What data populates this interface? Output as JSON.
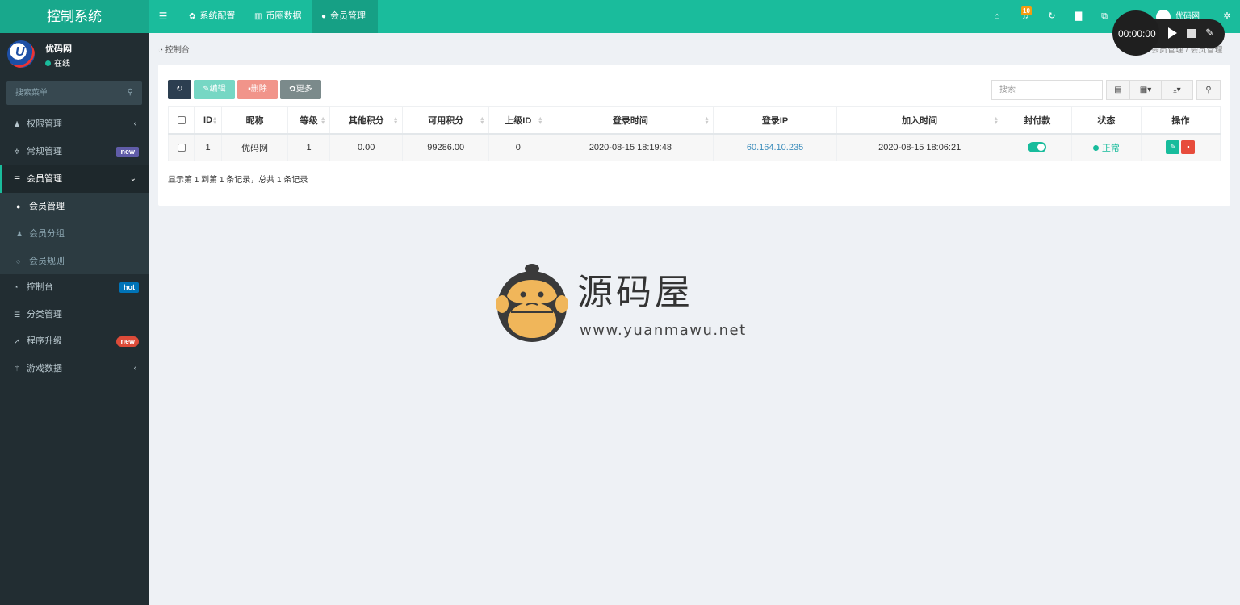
{
  "header": {
    "app_title": "控制系统",
    "tabs": [
      {
        "label": "系统配置",
        "icon": "gear-icon"
      },
      {
        "label": "币圈数据",
        "icon": "bar-chart-icon"
      },
      {
        "label": "会员管理",
        "icon": "user-icon"
      }
    ],
    "notification_count": "10",
    "user_name": "优码网"
  },
  "recorder": {
    "time": "00:00:00"
  },
  "sidebar": {
    "user_name": "优码网",
    "status": "在线",
    "search_placeholder": "搜索菜单",
    "items": [
      {
        "label": "权限管理",
        "icon": "users-icon"
      },
      {
        "label": "常规管理",
        "icon": "cogs-icon",
        "badge": "new"
      },
      {
        "label": "会员管理",
        "icon": "list-icon"
      },
      {
        "label": "控制台",
        "icon": "dashboard-icon",
        "badge": "hot"
      },
      {
        "label": "分类管理",
        "icon": "list-icon"
      },
      {
        "label": "程序升级",
        "icon": "rocket-icon",
        "badge": "new"
      },
      {
        "label": "游戏数据",
        "icon": "magic-icon"
      }
    ],
    "submenu": [
      {
        "label": "会员管理",
        "icon": "user-icon"
      },
      {
        "label": "会员分组",
        "icon": "users-icon"
      },
      {
        "label": "会员规则",
        "icon": "circle-icon"
      }
    ]
  },
  "breadcrumb": {
    "left": "控制台",
    "right_1": "会员管理",
    "right_2": "会员管理"
  },
  "toolbar": {
    "edit_label": "编辑",
    "delete_label": "删除",
    "more_label": "更多",
    "search_placeholder": "搜索"
  },
  "table": {
    "headers": [
      "ID",
      "昵称",
      "等级",
      "其他积分",
      "可用积分",
      "上级ID",
      "登录时间",
      "登录IP",
      "加入时间",
      "封付款",
      "状态",
      "操作"
    ],
    "rows": [
      {
        "id": "1",
        "nickname": "优码网",
        "level": "1",
        "other_points": "0.00",
        "available_points": "99286.00",
        "parent_id": "0",
        "login_time": "2020-08-15 18:19:48",
        "login_ip": "60.164.10.235",
        "join_time": "2020-08-15 18:06:21",
        "payment_enabled": true,
        "status": "正常"
      }
    ],
    "record_info": "显示第 1 到第 1 条记录，总共 1 条记录"
  },
  "watermark": {
    "title": "源码屋",
    "url": "www.yuanmawu.net"
  },
  "colors": {
    "header": "#1abc9c",
    "sidebar": "#222d32",
    "accent": "#18bc9c",
    "danger": "#e74c3c"
  }
}
